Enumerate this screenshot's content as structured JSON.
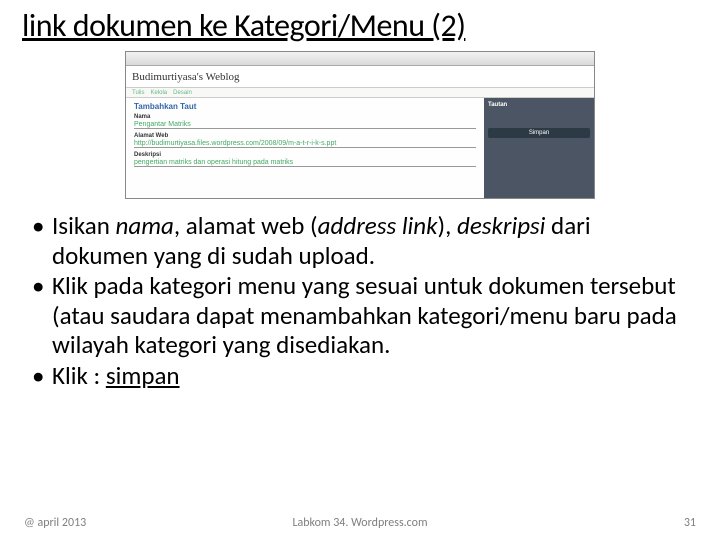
{
  "slide": {
    "title": "link dokumen ke Kategori/Menu (2)"
  },
  "screenshot": {
    "blog_title": "Budimurtiyasa's Weblog",
    "section": "Tambahkan Taut",
    "labels": {
      "nama": "Nama",
      "alamat": "Alamat Web",
      "deskripsi": "Deskripsi"
    },
    "values": {
      "nama": "Pengantar Matriks",
      "alamat": "http://budimurtiyasa.files.wordpress.com/2008/09/m-a-t-r-i-k-s.ppt",
      "deskripsi": "pengertian matriks dan operasi hitung pada matriks"
    },
    "side": {
      "title": "Tautan",
      "button": "Simpan"
    }
  },
  "bullets": {
    "b1_a": "Isikan ",
    "b1_b_i": "nama",
    "b1_c": ", alamat web (",
    "b1_d_i": "address link",
    "b1_e": "), ",
    "b1_f_i": "deskripsi",
    "b1_g": " dari dokumen yang di sudah upload.",
    "b2": "Klik pada kategori menu yang sesuai  untuk dokumen tersebut (atau saudara dapat menambahkan kategori/menu baru pada wilayah kategori yang disediakan.",
    "b3_a": "Klik : ",
    "b3_b_u": "simpan"
  },
  "footer": {
    "left": "@ april 2013",
    "center": "Labkom 34. Wordpress.com",
    "right": "31"
  }
}
